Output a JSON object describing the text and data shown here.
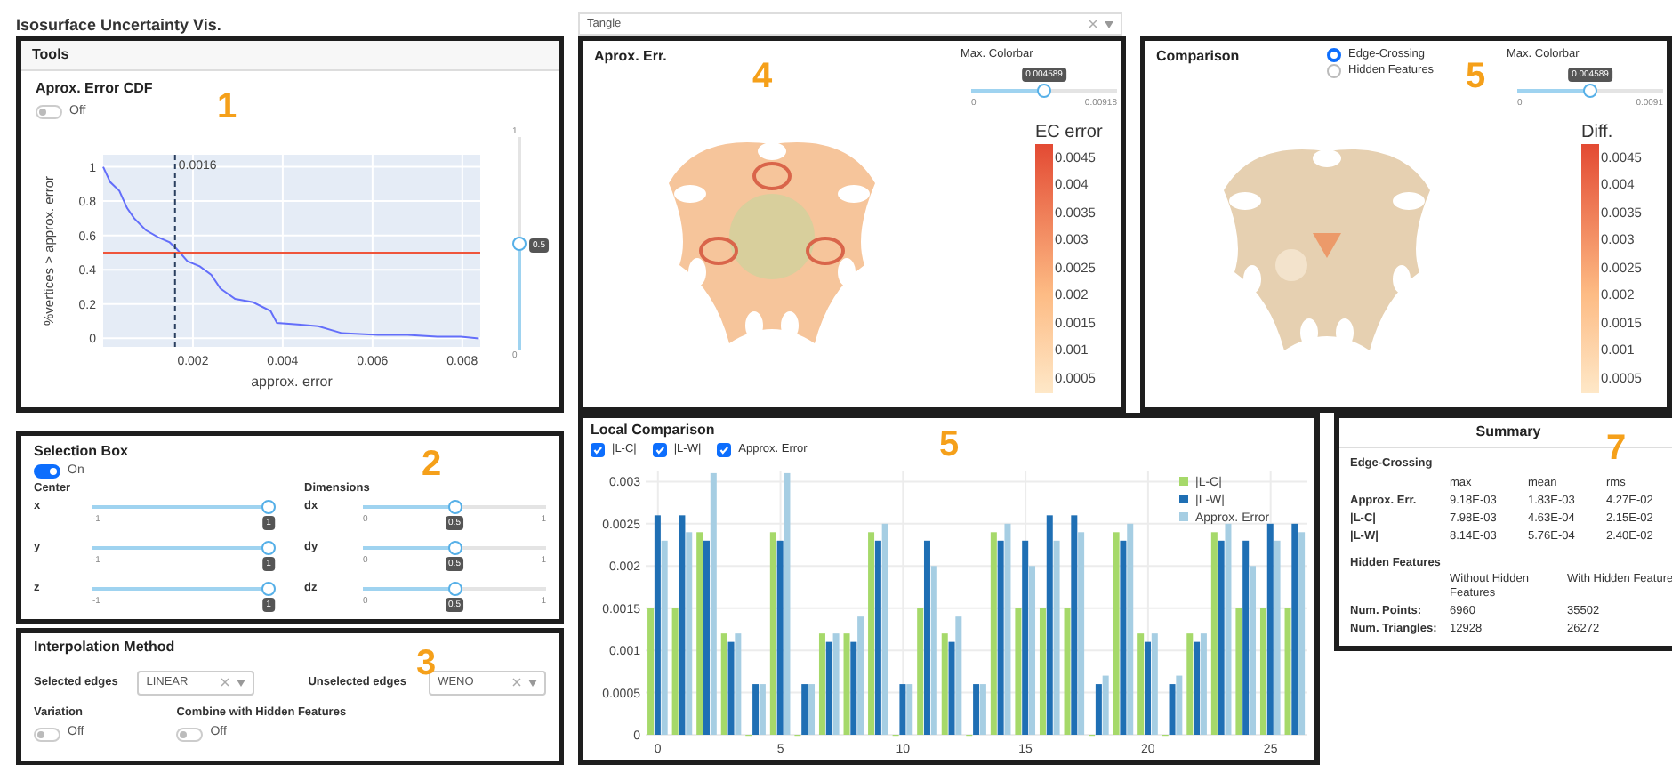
{
  "title": "Isosurface Uncertainty Vis.",
  "dataset_select": {
    "value": "Tangle"
  },
  "tools": {
    "header": "Tools",
    "marker": "1",
    "cdf": {
      "title": "Aprox. Error CDF",
      "toggle": {
        "label": "Off",
        "on": false
      },
      "chart_data": {
        "type": "line",
        "grid": true,
        "xlabel": "approx. error",
        "ylabel": "%vertices > approx. error",
        "xlim": [
          0,
          0.0084
        ],
        "ylim": [
          -0.05,
          1.07
        ],
        "xticks": [
          0.002,
          0.004,
          0.006,
          0.008
        ],
        "yticks": [
          0,
          0.2,
          0.4,
          0.6,
          0.8,
          1
        ],
        "x": [
          0,
          0.00016,
          0.00036,
          0.00053,
          0.00069,
          0.00095,
          0.00122,
          0.00148,
          0.00164,
          0.00188,
          0.00215,
          0.00241,
          0.00261,
          0.00294,
          0.00334,
          0.00373,
          0.00387,
          0.0044,
          0.00479,
          0.00532,
          0.00612,
          0.00678,
          0.00744,
          0.00797,
          0.00837
        ],
        "series": [
          {
            "color": "#636efa",
            "values": [
              1,
              0.91,
              0.86,
              0.76,
              0.7,
              0.63,
              0.59,
              0.56,
              0.52,
              0.45,
              0.42,
              0.37,
              0.29,
              0.23,
              0.21,
              0.16,
              0.09,
              0.08,
              0.07,
              0.03,
              0.02,
              0.02,
              0.01,
              0.01,
              0
            ]
          }
        ],
        "ref_lines": [
          {
            "axis": "y",
            "value": 0.5,
            "color": "#ef553b"
          },
          {
            "axis": "x",
            "value": 0.0016,
            "label": "0.0016",
            "color": "#2a3f5f"
          }
        ]
      },
      "threshold_slider": {
        "max_label": "1",
        "min_label": "0",
        "value": "0.5",
        "level": 0.5
      }
    }
  },
  "approx_view": {
    "title": "Aprox. Err.",
    "marker": "4",
    "colorbar_slider": {
      "label": "Max. Colorbar",
      "min": "0",
      "max": "0.00918",
      "value": "0.004589",
      "level": 0.5
    },
    "colorbar": {
      "title": "EC error",
      "ticks": [
        "0.0045",
        "0.004",
        "0.0035",
        "0.003",
        "0.0025",
        "0.002",
        "0.0015",
        "0.001",
        "0.0005"
      ]
    }
  },
  "comparison_view": {
    "title": "Comparison",
    "marker": "5",
    "radios": [
      {
        "label": "Edge-Crossing",
        "selected": true
      },
      {
        "label": "Hidden Features",
        "selected": false
      }
    ],
    "colorbar_slider": {
      "label": "Max. Colorbar",
      "min": "0",
      "max": "0.0091",
      "value": "0.004589",
      "level": 0.5
    },
    "colorbar": {
      "title": "Diff.",
      "ticks": [
        "0.0045",
        "0.004",
        "0.0035",
        "0.003",
        "0.0025",
        "0.002",
        "0.0015",
        "0.001",
        "0.0005"
      ]
    }
  },
  "selection_box": {
    "title": "Selection Box",
    "marker": "2",
    "toggle": {
      "label": "On",
      "on": true
    },
    "center": {
      "title": "Center",
      "sliders": [
        {
          "label": "x",
          "min": "-1",
          "value": "1",
          "level": 1
        },
        {
          "label": "y",
          "min": "-1",
          "value": "1",
          "level": 1
        },
        {
          "label": "z",
          "min": "-1",
          "value": "1",
          "level": 1
        }
      ]
    },
    "dimensions": {
      "title": "Dimensions",
      "sliders": [
        {
          "label": "dx",
          "min": "0",
          "max": "1",
          "value": "0.5",
          "level": 0.5
        },
        {
          "label": "dy",
          "min": "0",
          "max": "1",
          "value": "0.5",
          "level": 0.5
        },
        {
          "label": "dz",
          "min": "0",
          "max": "1",
          "value": "0.5",
          "level": 0.5
        }
      ]
    }
  },
  "interpolation": {
    "title": "Interpolation Method",
    "marker": "3",
    "selects": [
      {
        "label": "Selected edges",
        "value": "LINEAR"
      },
      {
        "label": "Unselected edges",
        "value": "WENO"
      }
    ],
    "toggles": [
      {
        "title": "Variation",
        "label": "Off",
        "on": false
      },
      {
        "title": "Combine with Hidden Features",
        "label": "Off",
        "on": false
      }
    ]
  },
  "local_comparison": {
    "title": "Local Comparison",
    "marker": "5",
    "checkboxes": [
      {
        "label": "|L-C|",
        "checked": true
      },
      {
        "label": "|L-W|",
        "checked": true
      },
      {
        "label": "Approx. Error",
        "checked": true
      }
    ],
    "chart_data": {
      "type": "bar",
      "grid": true,
      "legend": "upper right",
      "x": [
        0,
        1,
        2,
        3,
        4,
        5,
        6,
        7,
        8,
        9,
        10,
        11,
        12,
        13,
        14,
        15,
        16,
        17,
        18,
        19,
        20,
        21,
        22,
        23,
        24,
        25,
        26
      ],
      "xlim": [
        -0.5,
        26.5
      ],
      "xticks": [
        0,
        5,
        10,
        15,
        20,
        25
      ],
      "yticks": [
        0,
        0.0005,
        0.001,
        0.0015,
        0.002,
        0.0025,
        0.003
      ],
      "ylim": [
        0,
        0.00312
      ],
      "series": [
        {
          "name": "|L-C|",
          "color": "#a6d96a",
          "values": [
            0.0015,
            0.0015,
            0.0024,
            0.0012,
            0,
            0.0024,
            0,
            0.0012,
            0.0012,
            0.0024,
            0,
            0.0015,
            0.0012,
            0,
            0.0024,
            0.0015,
            0.0015,
            0.0015,
            0,
            0.0024,
            0.0012,
            0,
            0.0012,
            0.0024,
            0.0015,
            0.0015,
            0.0015
          ]
        },
        {
          "name": "|L-W|",
          "color": "#1f6fb4",
          "values": [
            0.0026,
            0.0026,
            0.0023,
            0.0011,
            0.0006,
            0.0023,
            0.0006,
            0.0011,
            0.0011,
            0.0023,
            0.0006,
            0.0023,
            0.0011,
            0.0006,
            0.0023,
            0.0023,
            0.0026,
            0.0026,
            0.0006,
            0.0023,
            0.0011,
            0.0006,
            0.0011,
            0.0023,
            0.0023,
            0.0025,
            0.0025
          ]
        },
        {
          "name": "Approx. Error",
          "color": "#a6cee3",
          "values": [
            0.0023,
            0.0024,
            0.0031,
            0.0012,
            0.0006,
            0.0031,
            0.0006,
            0.0012,
            0.0014,
            0.0025,
            0.0006,
            0.002,
            0.0014,
            0.0006,
            0.0025,
            0.002,
            0.0023,
            0.0024,
            0.0007,
            0.0025,
            0.0012,
            0.0007,
            0.0012,
            0.0025,
            0.002,
            0.0023,
            0.0024
          ]
        }
      ]
    }
  },
  "summary": {
    "title": "Summary",
    "marker": "7",
    "edge_crossing": {
      "title": "Edge-Crossing",
      "columns": [
        "max",
        "mean",
        "rms"
      ],
      "rows": [
        {
          "label": "Approx. Err.",
          "values": [
            "9.18E-03",
            "1.83E-03",
            "4.27E-02"
          ]
        },
        {
          "label": "|L-C|",
          "values": [
            "7.98E-03",
            "4.63E-04",
            "2.15E-02"
          ]
        },
        {
          "label": "|L-W|",
          "values": [
            "8.14E-03",
            "5.76E-04",
            "2.40E-02"
          ]
        }
      ]
    },
    "hidden_features": {
      "title": "Hidden Features",
      "columns": [
        "Without Hidden Features",
        "With Hidden Feature"
      ],
      "rows": [
        {
          "label": "Num. Points:",
          "values": [
            "6960",
            "35502"
          ]
        },
        {
          "label": "Num. Triangles:",
          "values": [
            "12928",
            "26272"
          ]
        }
      ]
    }
  }
}
